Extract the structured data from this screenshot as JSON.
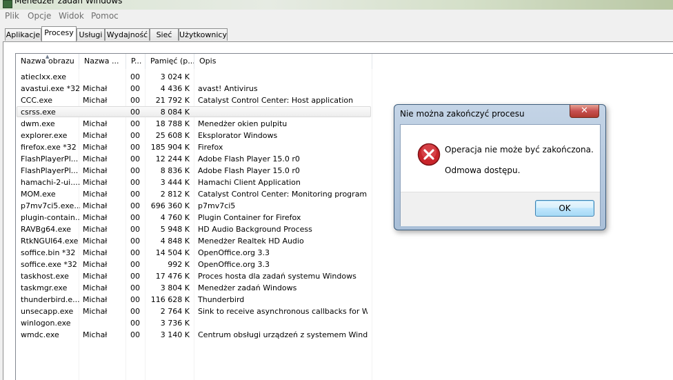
{
  "window": {
    "title": "Menedżer zadań Windows"
  },
  "menu": [
    "Plik",
    "Opcje",
    "Widok",
    "Pomoc"
  ],
  "tabs": [
    "Aplikacje",
    "Procesy",
    "Usługi",
    "Wydajność",
    "Sieć",
    "Użytkownicy"
  ],
  "active_tab": "Procesy",
  "columns": [
    "Nazwa obrazu",
    "Nazwa ...",
    "P...",
    "Pamięć (p...",
    "Opis"
  ],
  "processes": [
    {
      "name": "atieclxx.exe",
      "user": "",
      "cpu": "00",
      "mem": "3 024 K",
      "desc": ""
    },
    {
      "name": "avastui.exe *32",
      "user": "Michał",
      "cpu": "00",
      "mem": "4 436 K",
      "desc": "avast! Antivirus"
    },
    {
      "name": "CCC.exe",
      "user": "Michał",
      "cpu": "00",
      "mem": "21 792 K",
      "desc": "Catalyst Control Center: Host application"
    },
    {
      "name": "csrss.exe",
      "user": "",
      "cpu": "00",
      "mem": "8 084 K",
      "desc": ""
    },
    {
      "name": "dwm.exe",
      "user": "Michał",
      "cpu": "00",
      "mem": "18 788 K",
      "desc": "Menedżer okien pulpitu"
    },
    {
      "name": "explorer.exe",
      "user": "Michał",
      "cpu": "00",
      "mem": "25 608 K",
      "desc": "Eksplorator Windows"
    },
    {
      "name": "firefox.exe *32",
      "user": "Michał",
      "cpu": "00",
      "mem": "185 904 K",
      "desc": "Firefox"
    },
    {
      "name": "FlashPlayerPl...",
      "user": "Michał",
      "cpu": "00",
      "mem": "12 244 K",
      "desc": "Adobe Flash Player 15.0 r0"
    },
    {
      "name": "FlashPlayerPl...",
      "user": "Michał",
      "cpu": "00",
      "mem": "8 836 K",
      "desc": "Adobe Flash Player 15.0 r0"
    },
    {
      "name": "hamachi-2-ui....",
      "user": "Michał",
      "cpu": "00",
      "mem": "3 444 K",
      "desc": "Hamachi Client Application"
    },
    {
      "name": "MOM.exe",
      "user": "Michał",
      "cpu": "00",
      "mem": "2 812 K",
      "desc": "Catalyst Control Center: Monitoring program"
    },
    {
      "name": "p7mv7ci5.exe....",
      "user": "Michał",
      "cpu": "00",
      "mem": "696 360 K",
      "desc": "p7mv7ci5"
    },
    {
      "name": "plugin-contain...",
      "user": "Michał",
      "cpu": "00",
      "mem": "4 760 K",
      "desc": "Plugin Container for Firefox"
    },
    {
      "name": "RAVBg64.exe",
      "user": "Michał",
      "cpu": "00",
      "mem": "5 948 K",
      "desc": "HD Audio Background Process"
    },
    {
      "name": "RtkNGUI64.exe",
      "user": "Michał",
      "cpu": "00",
      "mem": "4 848 K",
      "desc": "Menedżer Realtek HD Audio"
    },
    {
      "name": "soffice.bin *32",
      "user": "Michał",
      "cpu": "00",
      "mem": "14 504 K",
      "desc": "OpenOffice.org 3.3"
    },
    {
      "name": "soffice.exe *32",
      "user": "Michał",
      "cpu": "00",
      "mem": "992 K",
      "desc": "OpenOffice.org 3.3"
    },
    {
      "name": "taskhost.exe",
      "user": "Michał",
      "cpu": "00",
      "mem": "17 476 K",
      "desc": "Proces hosta dla zadań systemu Windows"
    },
    {
      "name": "taskmgr.exe",
      "user": "Michał",
      "cpu": "00",
      "mem": "3 804 K",
      "desc": "Menedżer zadań Windows"
    },
    {
      "name": "thunderbird.e...",
      "user": "Michał",
      "cpu": "00",
      "mem": "116 628 K",
      "desc": "Thunderbird"
    },
    {
      "name": "unsecapp.exe",
      "user": "Michał",
      "cpu": "00",
      "mem": "2 764 K",
      "desc": "Sink to receive asynchronous callbacks for WMI ..."
    },
    {
      "name": "winlogon.exe",
      "user": "",
      "cpu": "00",
      "mem": "3 736 K",
      "desc": ""
    },
    {
      "name": "wmdc.exe",
      "user": "Michał",
      "cpu": "00",
      "mem": "3 140 K",
      "desc": "Centrum obsługi urządzeń z systemem Windows..."
    }
  ],
  "selected_process": "csrss.exe",
  "dialog": {
    "title": "Nie można zakończyć procesu",
    "message": "Operacja nie może być zakończona.",
    "detail": "Odmowa dostępu.",
    "ok_label": "OK",
    "close_symbol": "✕"
  },
  "colors": {
    "dialog_frame": "#a9bfd8",
    "error_icon": "#c8242a",
    "selection": "#ececec"
  }
}
